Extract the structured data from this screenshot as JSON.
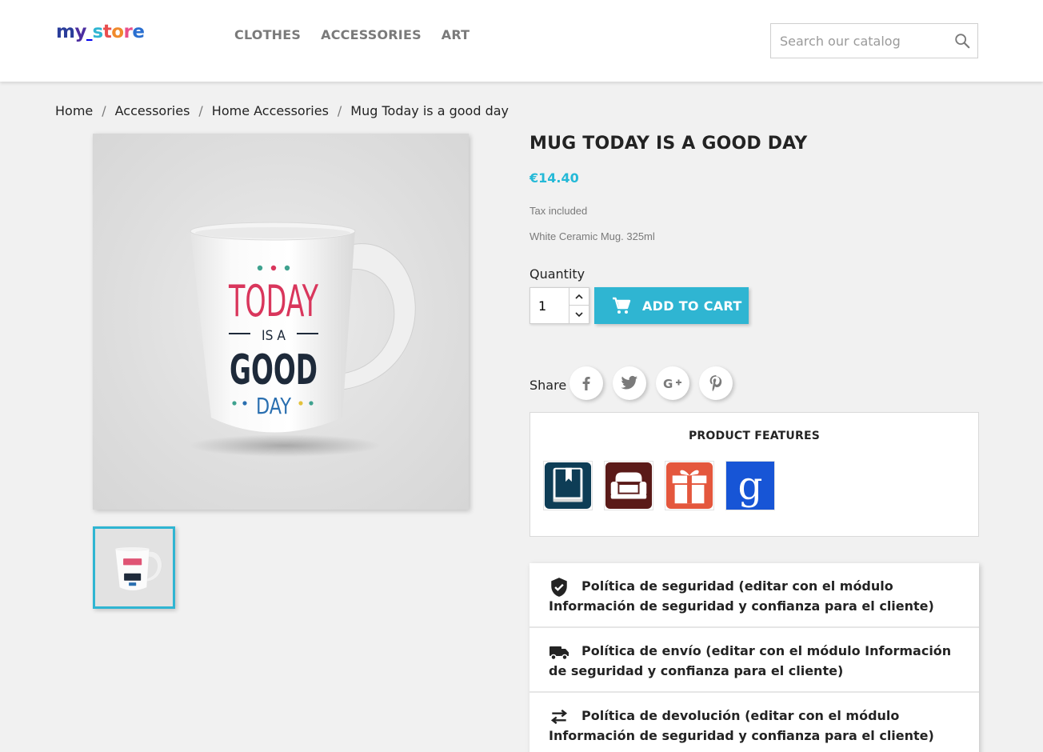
{
  "header": {
    "logo_text": "my store",
    "nav": [
      "CLOTHES",
      "ACCESSORIES",
      "ART"
    ],
    "search_placeholder": "Search our catalog"
  },
  "breadcrumb": [
    "Home",
    "Accessories",
    "Home Accessories",
    "Mug Today is a good day"
  ],
  "mug_print": {
    "line1": "TODAY",
    "line2": "IS A",
    "line3": "GOOD",
    "line4": "DAY"
  },
  "product": {
    "title": "MUG TODAY IS A GOOD DAY",
    "price": "€14.40",
    "tax": "Tax included",
    "short_description": "White Ceramic Mug. 325ml",
    "quantity_label": "Quantity",
    "quantity_value": "1",
    "add_to_cart": "ADD TO CART",
    "share_label": "Share",
    "share_buttons": [
      "facebook-icon",
      "twitter-icon",
      "google-plus-icon",
      "pinterest-icon"
    ]
  },
  "features": {
    "title": "PRODUCT FEATURES",
    "icons": [
      "book-icon",
      "armchair-icon",
      "gift-icon",
      "google-icon"
    ]
  },
  "reassurance": [
    {
      "icon": "shield-check-icon",
      "text": "Política de seguridad (editar con el módulo Información de seguridad y confianza para el cliente)"
    },
    {
      "icon": "truck-icon",
      "text": "Política de envío (editar con el módulo Información de seguridad y confianza para el cliente)"
    },
    {
      "icon": "swap-arrows-icon",
      "text": "Política de devolución (editar con el módulo Información de seguridad y confianza para el cliente)"
    }
  ],
  "colors": {
    "accent": "#2fb5d2",
    "price": "#24b9d7",
    "text": "#232323",
    "muted": "#7a7a7a"
  }
}
